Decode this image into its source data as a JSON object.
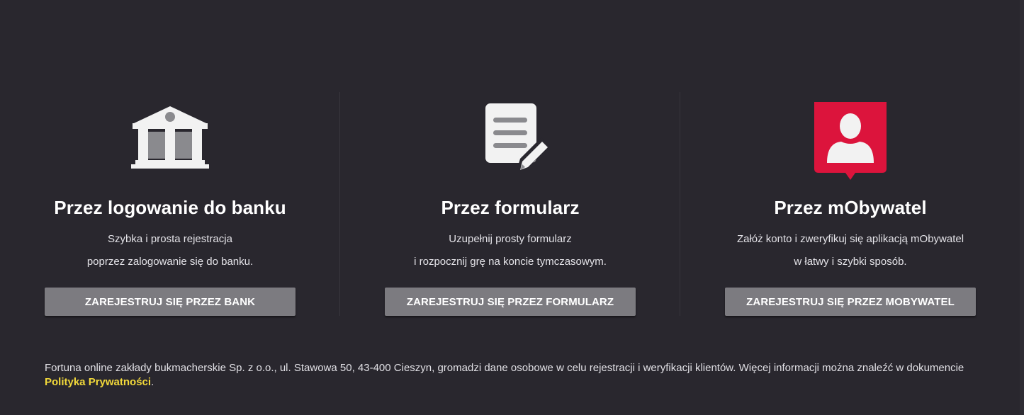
{
  "colors": {
    "background": "#29272e",
    "button": "#7c7b80",
    "link": "#f2d93a",
    "mobywatel_red": "#dc143c",
    "icon_light": "#f2f2f2",
    "icon_gray": "#8a8a8e"
  },
  "options": [
    {
      "icon": "bank-icon",
      "title": "Przez logowanie do banku",
      "desc_line1": "Szybka i prosta rejestracja",
      "desc_line2": "poprzez zalogowanie się do banku.",
      "button_label": "ZAREJESTRUJ SIĘ PRZEZ BANK"
    },
    {
      "icon": "form-pencil-icon",
      "title": "Przez formularz",
      "desc_line1": "Uzupełnij prosty formularz",
      "desc_line2": "i rozpocznij grę na koncie tymczasowym.",
      "button_label": "ZAREJESTRUJ SIĘ PRZEZ FORMULARZ"
    },
    {
      "icon": "mobywatel-user-shield-icon",
      "title": "Przez mObywatel",
      "desc_line1": "Załóż konto i zweryfikuj się aplikacją mObywatel",
      "desc_line2": "w łatwy i szybki sposób.",
      "button_label": "ZAREJESTRUJ SIĘ PRZEZ MOBYWATEL"
    }
  ],
  "footer": {
    "text_before": "Fortuna online zakłady bukmacherskie Sp. z o.o., ul. Stawowa 50, 43-400 Cieszyn, gromadzi dane osobowe w celu rejestracji i weryfikacji klientów. Więcej informacji można znaleźć w dokumencie ",
    "link_text": "Polityka Prywatności",
    "text_after": "."
  }
}
